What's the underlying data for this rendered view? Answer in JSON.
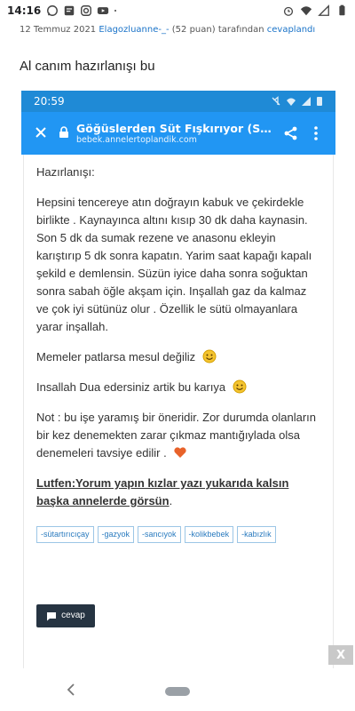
{
  "status_bar": {
    "time": "14:16",
    "left_icons": [
      "whatsapp-icon",
      "message-icon",
      "instagram-icon",
      "youtube-icon",
      "dot-icon"
    ],
    "right_icons": [
      "alarm-icon",
      "wifi-icon",
      "signal-icon",
      "battery-icon"
    ]
  },
  "meta": {
    "date": "12 Temmuz 2021",
    "user": "Elagozluanne-_-",
    "points": "(52 puan)",
    "by": "tarafından",
    "action": "cevaplandı"
  },
  "answer_title": "Al canım hazırlanışı bu",
  "screenshot": {
    "status_time": "20:59",
    "toolbar": {
      "title": "Göğüslerden Süt Fışkırıyor (Süt ...",
      "url": "bebek.annelertoplandik.com"
    },
    "heading": "Hazırlanışı:",
    "paragraph1": "Hepsini tencereye atın doğrayın kabuk ve çekirdekle birlikte . Kaynayınca altını kısıp 30 dk daha kaynasin. Son 5 dk da sumak rezene ve anasonu ekleyin karıştırıp 5 dk sonra kapatın. Yarim saat kapağı kapalı şekild e demlensin.  Süzün iyice daha sonra soğuktan sonra sabah öğle akşam için.  Inşallah gaz da kalmaz ve çok iyi sütünüz olur . Özellik le sütü olmayanlara yarar inşallah.",
    "paragraph2": "Memeler patlarsa mesul değiliz",
    "paragraph3": "Insallah Dua edersiniz artik bu karıya",
    "paragraph4": "Not : bu işe yaramış bir öneridir.  Zor durumda olanların bir kez denemekten zarar çıkmaz mantığıylada olsa denemeleri tavsiye edilir .",
    "ask_text": "Lutfen:Yorum yapın kızlar yazı yukarıda kalsın başka annelerde görsün",
    "ask_end": ".",
    "tags": [
      "-sütartırıcıçay",
      "-gazyok",
      "-sancıyok",
      "-kolikbebek",
      "-kabızlık"
    ],
    "reply_label": "cevap"
  },
  "close_label": "X",
  "colors": {
    "toolbar": "#2196f3",
    "phone_status": "#1f8ad6",
    "link": "#1a73c8",
    "tag_border": "#9cc6e6",
    "reply_button": "#263442"
  }
}
